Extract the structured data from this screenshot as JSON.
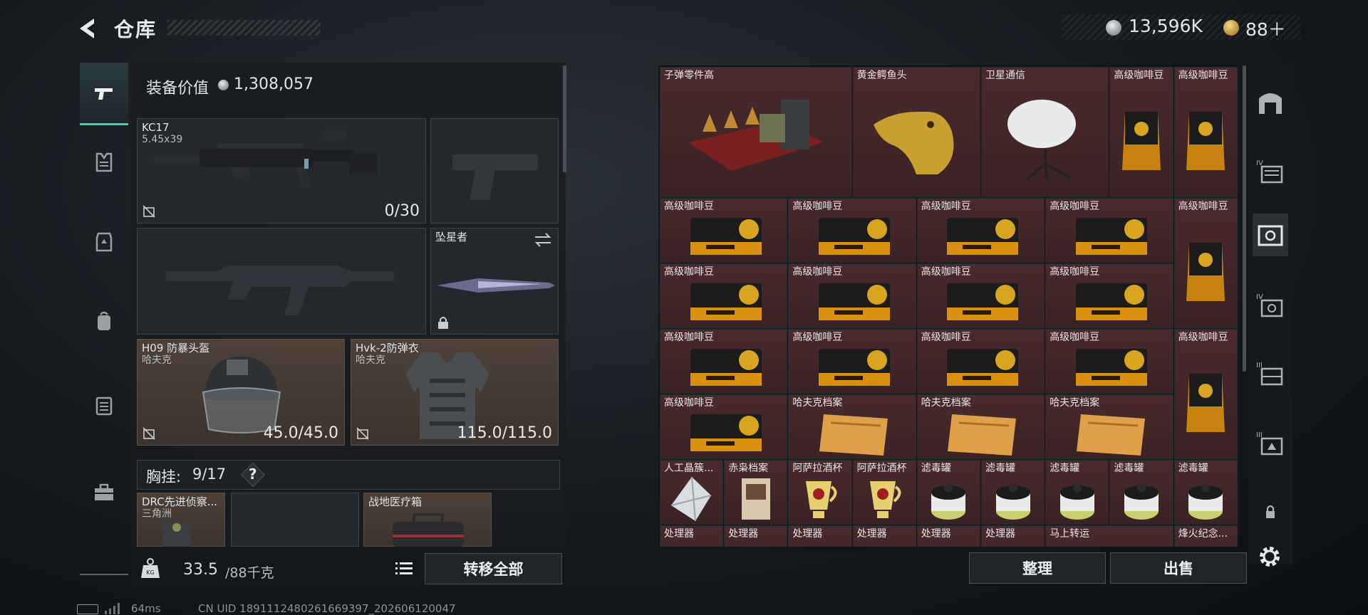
{
  "header": {
    "title": "仓库",
    "silver_value": "13,596K",
    "gold_value": "88＋"
  },
  "equipment": {
    "value_label": "装备价值",
    "value": "1,308,057",
    "primary_weapon": {
      "name": "KC17",
      "caliber": "5.45x39",
      "ammo": "0/30"
    },
    "melee": {
      "name": "坠星者"
    },
    "helmet": {
      "name": "H09 防暴头盔",
      "brand": "哈夫克",
      "durability": "45.0/45.0"
    },
    "armor": {
      "name": "Hvk-2防弹衣",
      "brand": "哈夫克",
      "durability": "115.0/115.0"
    },
    "chest_rig": {
      "label": "胸挂:",
      "count": "9/17",
      "help": "?"
    },
    "rig_items": [
      {
        "name": "DRC先进侦察...",
        "brand": "三角洲"
      },
      {
        "name": "战地医疗箱",
        "brand": ""
      }
    ],
    "weight_value": "33.5",
    "weight_unit": "/88千克",
    "transfer_all_label": "转移全部"
  },
  "inventory": {
    "items": [
      "子弹零件高",
      "黄金鳄鱼头",
      "卫星通信",
      "高级咖啡豆",
      "高级咖啡豆",
      "高级咖啡豆",
      "高级咖啡豆",
      "高级咖啡豆",
      "高级咖啡豆",
      "高级咖啡豆",
      "高级咖啡豆",
      "高级咖啡豆",
      "高级咖啡豆",
      "高级咖啡豆",
      "高级咖啡豆",
      "高级咖啡豆",
      "高级咖啡豆",
      "高级咖啡豆",
      "高级咖啡豆",
      "高级咖啡豆",
      "哈夫克档案",
      "哈夫克档案",
      "哈夫克档案",
      "人工晶簇...",
      "赤枭档案",
      "阿萨拉酒杯",
      "阿萨拉酒杯",
      "滤毒罐",
      "滤毒罐",
      "滤毒罐",
      "滤毒罐",
      "滤毒罐",
      "处理器",
      "处理器",
      "处理器",
      "处理器",
      "处理器",
      "处理器",
      "马上转运",
      "烽火纪念..."
    ],
    "sort_label": "整理",
    "sell_label": "出售"
  },
  "status": {
    "ping": "64ms",
    "uid": "CN UID 1891112480261669397_202606120047"
  },
  "colors": {
    "accent": "#3fd0b8",
    "cell_bg": "#4a2a2c",
    "slot_brown": "#4d4138"
  }
}
